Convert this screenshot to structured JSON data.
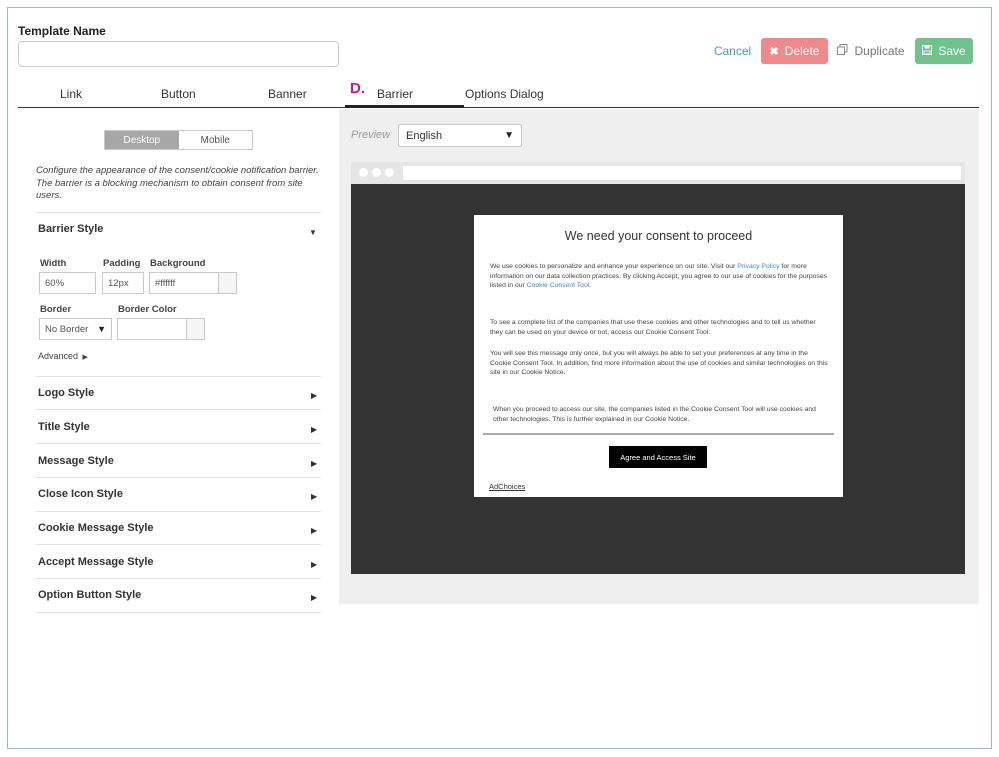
{
  "template": {
    "label": "Template Name",
    "value": ""
  },
  "actions": {
    "cancel": "Cancel",
    "delete": "Delete",
    "duplicate": "Duplicate",
    "save": "Save"
  },
  "marker": "D.",
  "tabs": [
    {
      "label": "Link"
    },
    {
      "label": "Button"
    },
    {
      "label": "Banner"
    },
    {
      "label": "Barrier",
      "active": true
    },
    {
      "label": "Options Dialog"
    }
  ],
  "device_toggle": {
    "desktop": "Desktop",
    "mobile": "Mobile",
    "selected": "Desktop"
  },
  "description": "Configure the appearance of the consent/cookie notification barrier. The barrier is a blocking mechanism to obtain consent from site users.",
  "barrier_style": {
    "title": "Barrier Style",
    "width_label": "Width",
    "width_value": "60%",
    "padding_label": "Padding",
    "padding_value": "12px",
    "background_label": "Background",
    "background_value": "#ffffff",
    "border_label": "Border",
    "border_value": "No Border",
    "border_color_label": "Border Color",
    "border_color_value": "",
    "advanced": "Advanced"
  },
  "sections": [
    "Logo Style",
    "Title Style",
    "Message Style",
    "Close Icon Style",
    "Cookie Message Style",
    "Accept Message Style",
    "Option Button Style"
  ],
  "preview": {
    "label": "Preview",
    "language": "English",
    "modal_title": "We need your consent to proceed",
    "p1_a": "We use cookies to personalize and enhance your experience on our site. Visit our ",
    "p1_link1": "Privacy Policy",
    "p1_b": " for more information on our data collection practices. By clicking Accept, you agree to our use of cookies for the purposes listed in our ",
    "p1_link2": "Cookie Consent Tool",
    "p1_c": ".",
    "p2": "To see a complete list of the companies that use these cookies and other technologies and to tell us whether they can be used on your device or not, access our Cookie Consent Tool.",
    "p3": "You will see this message only once, but you will always be able to set your preferences at any time in the Cookie Consent Tool. In addition, find more information about the use of cookies and similar technologies on this site in our Cookie Notice.",
    "p4": "When you proceed to access our site, the companies listed in the Cookie Consent Tool will use cookies and other technologies. This is further explained in our Cookie Notice.",
    "agree_button": "Agree and Access Site",
    "adchoices": "AdChoices"
  },
  "colors": {
    "accent_link": "#3aa3c8",
    "delete": "#f08a8a",
    "save": "#6fc48b",
    "marker": "#c21a8c",
    "preview_backdrop": "#333333"
  },
  "icons": {
    "delete": "x-icon",
    "duplicate": "copy-icon",
    "save": "floppy-disk-icon",
    "select": "triangle-down-icon",
    "collapsed": "caret-right-icon",
    "expanded": "caret-down-icon"
  }
}
